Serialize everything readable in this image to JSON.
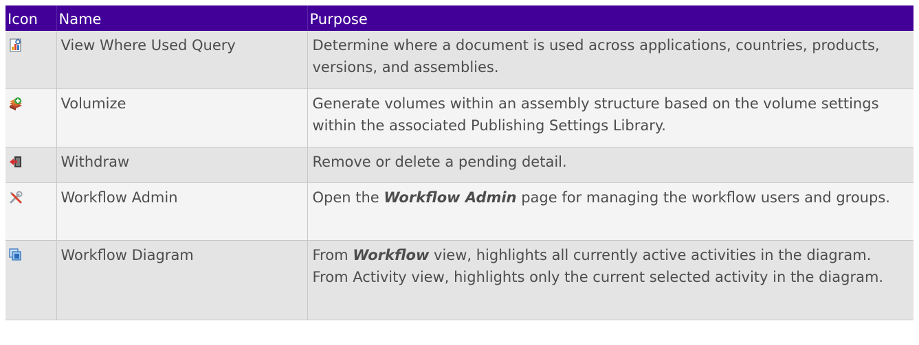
{
  "headers": {
    "icon": "Icon",
    "name": "Name",
    "purpose": "Purpose"
  },
  "rows": [
    {
      "icon": "where-used-query-icon",
      "name": "View Where Used Query",
      "purpose": "Determine where a document is used across applications, countries, products, versions, and assemblies."
    },
    {
      "icon": "volumize-icon",
      "name": "Volumize",
      "purpose": "Generate volumes within an assembly structure based on the volume settings within the associated Publishing Settings Library."
    },
    {
      "icon": "withdraw-icon",
      "name": "Withdraw",
      "purpose": "Remove or delete a pending detail."
    },
    {
      "icon": "workflow-admin-icon",
      "name": "Workflow Admin",
      "purpose_pre": "Open the ",
      "purpose_em": "Workflow Admin",
      "purpose_post": " page for managing the workflow users and groups."
    },
    {
      "icon": "workflow-diagram-icon",
      "name": "Workflow Diagram",
      "purpose_pre": "From ",
      "purpose_em": "Workflow",
      "purpose_post": " view, highlights all currently active activities in the diagram. From Activity view, highlights only the current selected activity in the diagram."
    }
  ]
}
